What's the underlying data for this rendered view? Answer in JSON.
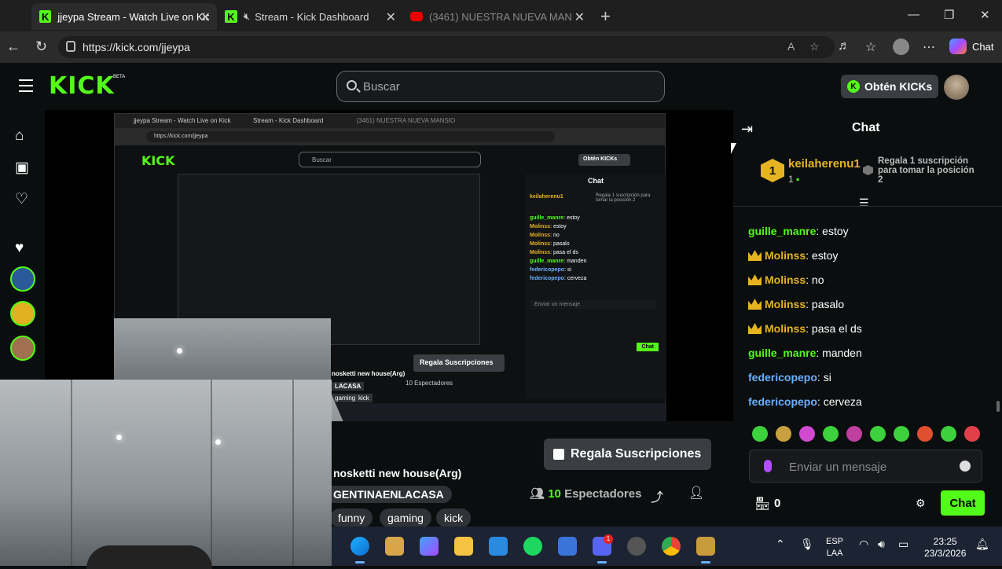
{
  "browser": {
    "tabs": [
      {
        "title": "jjeypa Stream - Watch Live on Kick",
        "active": true
      },
      {
        "title": "Stream - Kick Dashboard",
        "active": false
      },
      {
        "title": "(3461) NUESTRA NUEVA MANSIO",
        "active": false
      }
    ],
    "url": "https://kick.com/jjeypa",
    "copilot_label": "Chat"
  },
  "kick": {
    "logo": "KICK",
    "beta": "BETA",
    "search_placeholder": "Buscar",
    "kicks_button": "Obtén KICKs"
  },
  "stream": {
    "title_partial": "nosketti new house(Arg)",
    "tag_primary": "GENTINAENLACASA",
    "tags": [
      "funny",
      "gaming",
      "kick"
    ],
    "regala_button": "Regala Suscripciones",
    "viewers_count": "10",
    "viewers_label": "Espectadores"
  },
  "nested": {
    "tab1": "jjeypa Stream - Watch Live on Kick",
    "tab2": "Stream - Kick Dashboard",
    "tab3": "(3461) NUESTRA NUEVA MANSIO",
    "url": "https://kick.com/jjeypa",
    "search": "Buscar",
    "kicks": "Obtén KICKs",
    "chat_title": "Chat",
    "pin_user": "keilaherenu1",
    "pin_info": "Regala 1 suscripción para tomar la posición 2",
    "regala": "Regala Suscripciones",
    "viewers": "10 Espectadores",
    "title": "nosketti new house(Arg)",
    "tag": "LACASA",
    "tags": [
      "gaming",
      "kick"
    ],
    "input": "Enviar un mensaje",
    "send": "Chat",
    "messages": [
      {
        "user": "guille_manre",
        "text": "estoy"
      },
      {
        "user": "Molinss",
        "text": "estoy"
      },
      {
        "user": "Molinss",
        "text": "no"
      },
      {
        "user": "Molinss",
        "text": "pasalo"
      },
      {
        "user": "Molinss",
        "text": "pasa el ds"
      },
      {
        "user": "guille_manre",
        "text": "manden"
      },
      {
        "user": "federicopepo",
        "text": "si"
      },
      {
        "user": "federicopepo",
        "text": "cerveza"
      }
    ]
  },
  "chat": {
    "title": "Chat",
    "pinned": {
      "rank": "1",
      "user": "keilaherenu1",
      "count": "1",
      "info": "Regala 1 suscripción para tomar la posición 2"
    },
    "messages": [
      {
        "user": "guille_manre",
        "text": "estoy",
        "badge": false,
        "color": "#53fc18"
      },
      {
        "user": "Molinss",
        "text": "estoy",
        "badge": true,
        "color": "#e6b422"
      },
      {
        "user": "Molinss",
        "text": "no",
        "badge": true,
        "color": "#e6b422"
      },
      {
        "user": "Molinss",
        "text": "pasalo",
        "badge": true,
        "color": "#e6b422"
      },
      {
        "user": "Molinss",
        "text": "pasa el ds",
        "badge": true,
        "color": "#e6b422"
      },
      {
        "user": "guille_manre",
        "text": "manden",
        "badge": false,
        "color": "#53fc18"
      },
      {
        "user": "federicopepo",
        "text": "si",
        "badge": false,
        "color": "#6ab0ff"
      },
      {
        "user": "federicopepo",
        "text": "cerveza",
        "badge": false,
        "color": "#6ab0ff"
      }
    ],
    "input_placeholder": "Enviar un mensaje",
    "points": "0",
    "send_label": "Chat"
  },
  "taskbar": {
    "lang_top": "ESP",
    "lang_bottom": "LAA",
    "time": "23:25",
    "date": "23/3/2026",
    "discord_badge": "1"
  },
  "colors": {
    "kick_green": "#53fc18",
    "gold": "#e6b422",
    "background": "#0b0e0f"
  }
}
